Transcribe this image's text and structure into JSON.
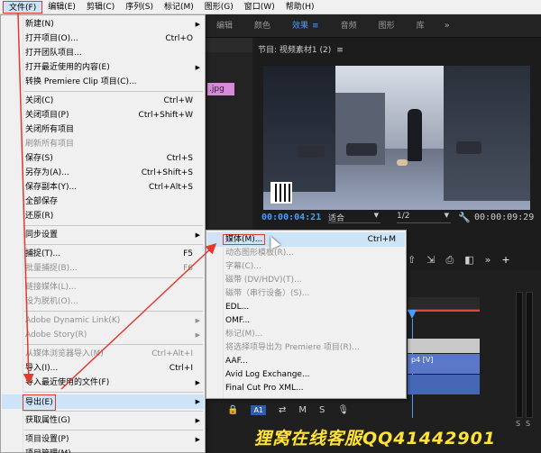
{
  "menubar": {
    "items": [
      {
        "label": "文件(F)",
        "active": true
      },
      {
        "label": "编辑(E)"
      },
      {
        "label": "剪辑(C)"
      },
      {
        "label": "序列(S)"
      },
      {
        "label": "标记(M)"
      },
      {
        "label": "图形(G)"
      },
      {
        "label": "窗口(W)"
      },
      {
        "label": "帮助(H)"
      }
    ]
  },
  "workspace_tabs": {
    "items": [
      "编辑",
      "颜色",
      "效果",
      "音频",
      "图形",
      "库"
    ],
    "active_index": 2,
    "more": "»",
    "hamburger": "≡"
  },
  "project_panel": {
    "pink_clip_label": ".jpg"
  },
  "program_monitor": {
    "title": "节目: 视频素材1 (2)",
    "timecode_current": "00:00:04:21",
    "timecode_duration": "00:00:09:29",
    "fit": "适合",
    "resolution": "1/2"
  },
  "transport_icons": [
    "⇧",
    "⇲",
    "⎙",
    "◧",
    "»",
    "+"
  ],
  "timeline": {
    "clip_label": "p4 [V]",
    "track_label": "A1"
  },
  "file_menu": {
    "items": [
      {
        "label": "新建(N)",
        "arrow": true
      },
      {
        "label": "打开项目(O)...",
        "shortcut": "Ctrl+O"
      },
      {
        "label": "打开团队项目..."
      },
      {
        "label": "打开最近使用的内容(E)",
        "arrow": true
      },
      {
        "label": "转换 Premiere Clip 项目(C)..."
      },
      {
        "sep": true
      },
      {
        "label": "关闭(C)",
        "shortcut": "Ctrl+W"
      },
      {
        "label": "关闭项目(P)",
        "shortcut": "Ctrl+Shift+W"
      },
      {
        "label": "关闭所有项目"
      },
      {
        "label": "刷新所有项目",
        "disabled": true
      },
      {
        "label": "保存(S)",
        "shortcut": "Ctrl+S"
      },
      {
        "label": "另存为(A)...",
        "shortcut": "Ctrl+Shift+S"
      },
      {
        "label": "保存副本(Y)...",
        "shortcut": "Ctrl+Alt+S"
      },
      {
        "label": "全部保存"
      },
      {
        "label": "还原(R)"
      },
      {
        "sep": true
      },
      {
        "label": "同步设置",
        "arrow": true
      },
      {
        "sep": true
      },
      {
        "label": "捕捉(T)...",
        "shortcut": "F5"
      },
      {
        "label": "批量捕捉(B)...",
        "shortcut": "F6",
        "disabled": true
      },
      {
        "sep": true
      },
      {
        "label": "链接媒体(L)...",
        "disabled": true
      },
      {
        "label": "设为脱机(O)...",
        "disabled": true
      },
      {
        "sep": true
      },
      {
        "label": "Adobe Dynamic Link(K)",
        "arrow": true,
        "disabled": true
      },
      {
        "label": "Adobe Story(R)",
        "arrow": true,
        "disabled": true
      },
      {
        "sep": true
      },
      {
        "label": "从媒体浏览器导入(M)",
        "shortcut": "Ctrl+Alt+I",
        "disabled": true
      },
      {
        "label": "导入(I)...",
        "shortcut": "Ctrl+I"
      },
      {
        "label": "导入最近使用的文件(F)",
        "arrow": true
      },
      {
        "sep": true
      },
      {
        "label": "导出(E)",
        "arrow": true,
        "highlight": true
      },
      {
        "sep": true
      },
      {
        "label": "获取属性(G)",
        "arrow": true
      },
      {
        "sep": true
      },
      {
        "label": "项目设置(P)",
        "arrow": true
      },
      {
        "label": "项目管理(M)..."
      }
    ]
  },
  "export_submenu": {
    "items": [
      {
        "label": "媒体(M)...",
        "shortcut": "Ctrl+M",
        "highlight": true
      },
      {
        "label": "动态图形模板(R)...",
        "disabled": true
      },
      {
        "label": "字幕(C)...",
        "disabled": true
      },
      {
        "label": "磁带 (DV/HDV)(T)...",
        "disabled": true
      },
      {
        "label": "磁带（串行设备）(S)...",
        "disabled": true
      },
      {
        "label": "EDL..."
      },
      {
        "label": "OMF..."
      },
      {
        "label": "标记(M)...",
        "disabled": true
      },
      {
        "label": "将选择项导出为 Premiere 项目(R)...",
        "disabled": true
      },
      {
        "label": "AAF..."
      },
      {
        "label": "Avid Log Exchange..."
      },
      {
        "label": "Final Cut Pro XML..."
      }
    ]
  },
  "watermark": "狸窝在线客服QQ41442901",
  "colors": {
    "annotation_red": "#e23b2e",
    "highlight": "#cde3f7",
    "accent_blue": "#4a9eff",
    "watermark": "#ffe23a"
  }
}
